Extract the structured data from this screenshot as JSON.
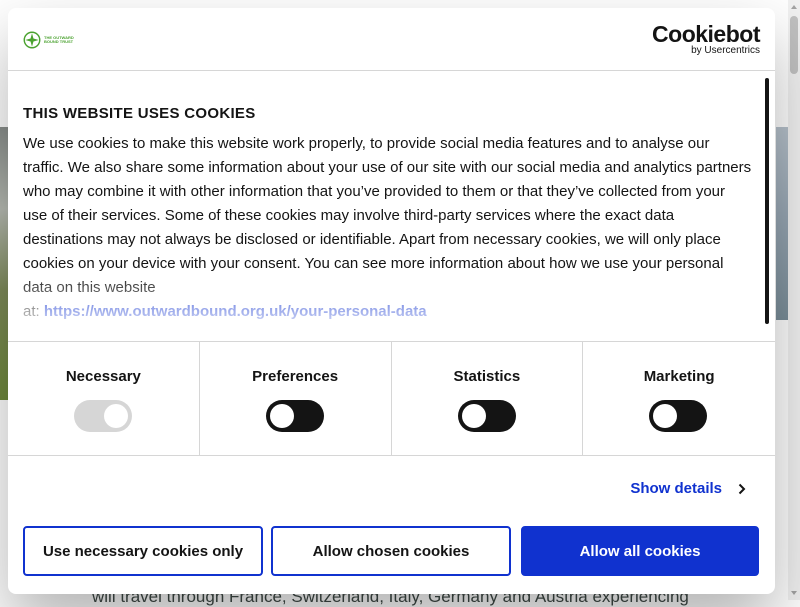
{
  "background": {
    "bottom_text": "will travel through France, Switzerland, Italy, Germany and Austria experiencing"
  },
  "header": {
    "brand_logo_text": "THE OUTWARD BOUND TRUST",
    "cookiebot_word": "Cookiebot",
    "cookiebot_sub": "by Usercentrics"
  },
  "content": {
    "title": "THIS WEBSITE USES COOKIES",
    "body": "We use cookies to make this website work properly, to provide social media features and to analyse our traffic. We also share some information about your use of our site with our social media and analytics partners who may combine it with other information that you’ve provided to them or that they’ve collected from your use of their services. Some of these cookies may involve third-party services where the exact data destinations may not always be disclosed or identifiable. Apart from necessary cookies, we will only place cookies on your device with your consent. You can see more information about how we use your personal data on this website",
    "link_prefix": "at: ",
    "link_text": "https://www.outwardbound.org.uk/your-personal-data"
  },
  "toggles": [
    {
      "label": "Necessary",
      "checked": true,
      "disabled": true
    },
    {
      "label": "Preferences",
      "checked": false,
      "disabled": false
    },
    {
      "label": "Statistics",
      "checked": false,
      "disabled": false
    },
    {
      "label": "Marketing",
      "checked": false,
      "disabled": false
    }
  ],
  "details": {
    "show_details_label": "Show details"
  },
  "buttons": {
    "necessary_only": "Use necessary cookies only",
    "allow_chosen": "Allow chosen cookies",
    "allow_all": "Allow all cookies"
  },
  "colors": {
    "accent": "#1032cf",
    "text": "#141414",
    "brand_green": "#4ba230",
    "divider": "#d6d6d6"
  },
  "icons": {
    "brand": "compass-emblem-icon",
    "show_details": "chevron-right-icon"
  }
}
